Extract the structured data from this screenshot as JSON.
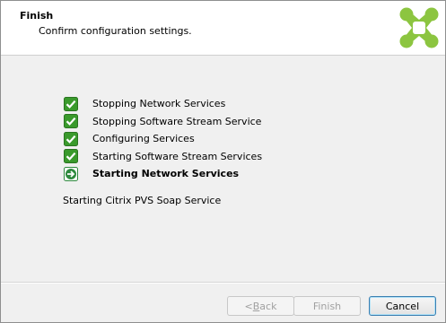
{
  "header": {
    "title": "Finish",
    "subtitle": "Confirm configuration settings."
  },
  "steps": [
    {
      "label": "Stopping Network Services",
      "state": "done",
      "icon": "checkmark-icon"
    },
    {
      "label": "Stopping Software Stream Service",
      "state": "done",
      "icon": "checkmark-icon"
    },
    {
      "label": "Configuring Services",
      "state": "done",
      "icon": "checkmark-icon"
    },
    {
      "label": "Starting Software Stream Services",
      "state": "done",
      "icon": "checkmark-icon"
    },
    {
      "label": "Starting Network Services",
      "state": "current",
      "icon": "arrow-right-icon"
    }
  ],
  "status": "Starting Citrix PVS Soap Service",
  "buttons": {
    "back_prefix": "< ",
    "back_underlined": "B",
    "back_rest": "ack",
    "finish": "Finish",
    "cancel": "Cancel"
  },
  "colors": {
    "check_green": "#3a9a2c",
    "arrow_green": "#2e8a3e",
    "logo_green": "#8cc540",
    "default_button_border": "#3c7fb1"
  }
}
